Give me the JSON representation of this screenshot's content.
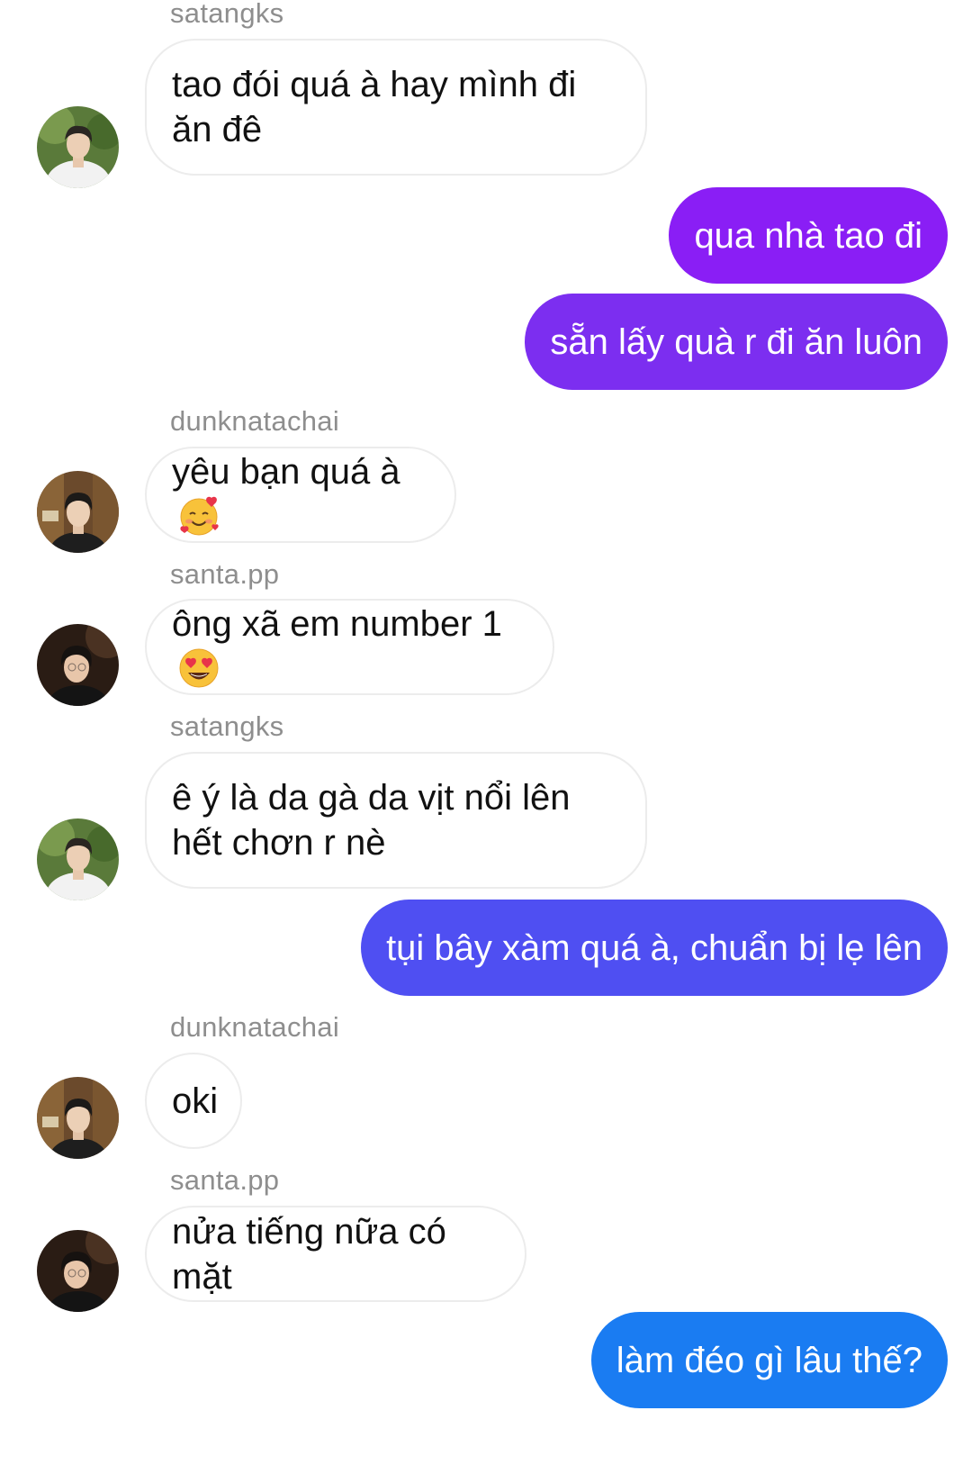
{
  "colors": {
    "bubble_out_1": "#8a1ef5",
    "bubble_out_2": "#7c2ef0",
    "bubble_out_3": "#4f4ff2",
    "bubble_out_4": "#1a7cf2",
    "bubble_in_border": "#ececec",
    "sender_name": "#8e8e8e"
  },
  "messages": [
    {
      "type": "sender",
      "name": "satangks"
    },
    {
      "type": "incoming",
      "avatar": "avatar-satangks",
      "text": "tao đói quá à hay mình đi ăn đê"
    },
    {
      "type": "outgoing",
      "text": "qua nhà tao đi"
    },
    {
      "type": "outgoing",
      "text": "sẵn lấy quà r đi ăn luôn"
    },
    {
      "type": "sender",
      "name": "dunknatachai"
    },
    {
      "type": "incoming",
      "avatar": "avatar-dunknatachai",
      "text": "yêu bạn quá à",
      "emoji": "smiling-face-with-hearts-icon"
    },
    {
      "type": "sender",
      "name": "santa.pp"
    },
    {
      "type": "incoming",
      "avatar": "avatar-santa",
      "text": "ông xã em number 1",
      "emoji": "heart-eyes-icon"
    },
    {
      "type": "sender",
      "name": "satangks"
    },
    {
      "type": "incoming",
      "avatar": "avatar-satangks",
      "text": "ê ý là da gà da vịt nổi lên hết chơn r nè"
    },
    {
      "type": "outgoing",
      "text": "tụi bây xàm quá à, chuẩn bị lẹ lên"
    },
    {
      "type": "sender",
      "name": "dunknatachai"
    },
    {
      "type": "incoming",
      "avatar": "avatar-dunknatachai",
      "text": "oki"
    },
    {
      "type": "sender",
      "name": "santa.pp"
    },
    {
      "type": "incoming",
      "avatar": "avatar-santa",
      "text": "nửa tiếng nữa có mặt"
    },
    {
      "type": "outgoing",
      "text": "làm đéo gì lâu thế?"
    }
  ]
}
